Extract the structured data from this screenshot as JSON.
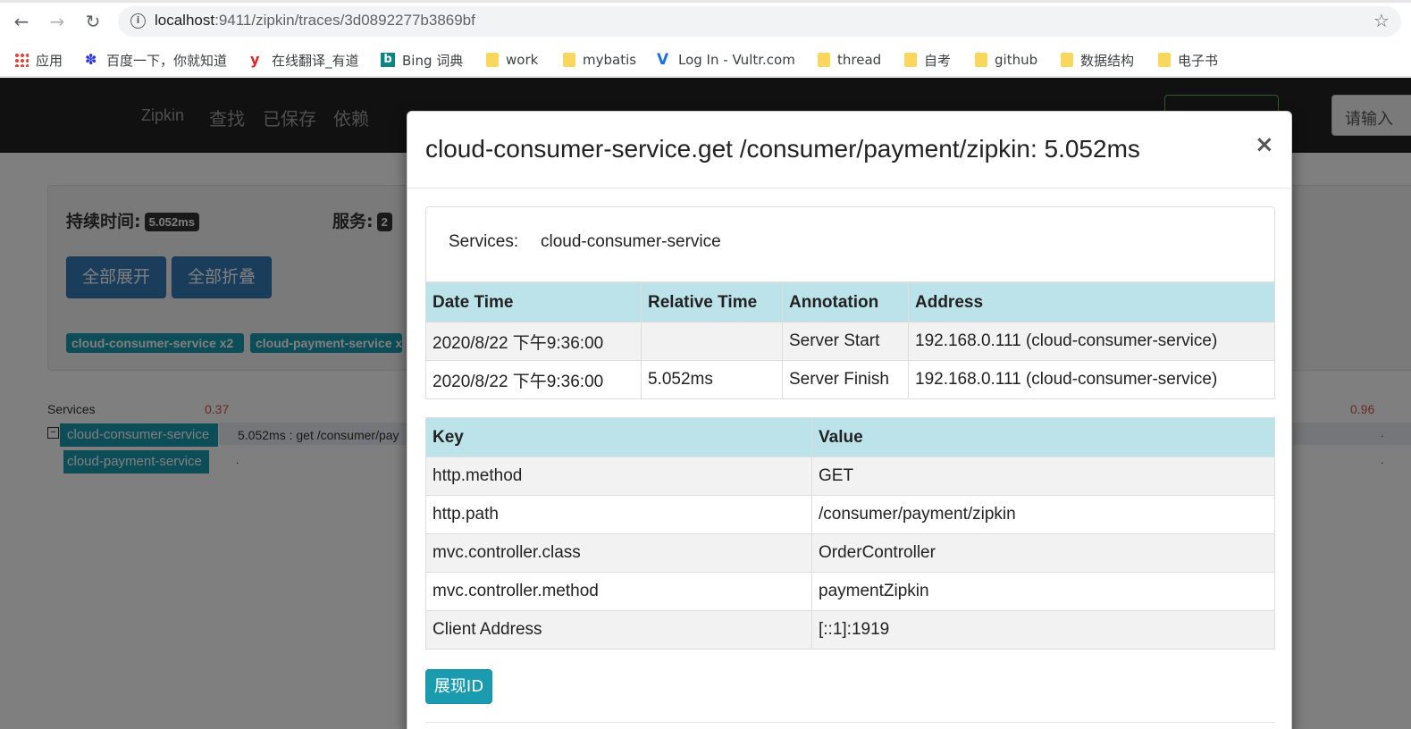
{
  "browser": {
    "url_host": "localhost",
    "url_path": ":9411/zipkin/traces/3d0892277b3869bf",
    "bookmarks": [
      {
        "label": "应用",
        "icon": "apps-grid-icon"
      },
      {
        "label": "百度一下，你就知道",
        "icon": "baidu-paw-icon"
      },
      {
        "label": "在线翻译_有道",
        "icon": "youdao-icon"
      },
      {
        "label": "Bing 词典",
        "icon": "bing-icon"
      },
      {
        "label": "work",
        "icon": "folder-icon"
      },
      {
        "label": "mybatis",
        "icon": "folder-icon"
      },
      {
        "label": "Log In - Vultr.com",
        "icon": "vultr-icon"
      },
      {
        "label": "thread",
        "icon": "folder-icon"
      },
      {
        "label": "自考",
        "icon": "folder-icon"
      },
      {
        "label": "github",
        "icon": "folder-icon"
      },
      {
        "label": "数据结构",
        "icon": "folder-icon"
      },
      {
        "label": "电子书",
        "icon": "folder-icon"
      }
    ]
  },
  "navbar": {
    "brand": "Zipkin",
    "links": [
      "查找",
      "已保存",
      "依赖"
    ],
    "search_placeholder": "请输入"
  },
  "summary": {
    "duration_label": "持续时间:",
    "duration_value": "5.052ms",
    "services_label": "服务:",
    "services_value": "2",
    "expand_all": "全部展开",
    "collapse_all": "全部折叠",
    "service_labels": [
      "cloud-consumer-service x2",
      "cloud-payment-service x"
    ]
  },
  "trace": {
    "services_header": "Services",
    "tick_left": "0.37",
    "tick_right": "0.96",
    "rows": [
      {
        "service": "cloud-consumer-service",
        "span": "5.052ms : get /consumer/pay"
      },
      {
        "service": "cloud-payment-service",
        "span": ""
      }
    ]
  },
  "modal": {
    "title": "cloud-consumer-service.get /consumer/payment/zipkin: 5.052ms",
    "services_label": "Services:",
    "services_value": "cloud-consumer-service",
    "annotation_headers": [
      "Date Time",
      "Relative Time",
      "Annotation",
      "Address"
    ],
    "annotations": [
      {
        "date_time": "2020/8/22 下午9:36:00",
        "relative_time": "",
        "annotation": "Server Start",
        "address": "192.168.0.111 (cloud-consumer-service)"
      },
      {
        "date_time": "2020/8/22 下午9:36:00",
        "relative_time": "5.052ms",
        "annotation": "Server Finish",
        "address": "192.168.0.111 (cloud-consumer-service)"
      }
    ],
    "kv_headers": [
      "Key",
      "Value"
    ],
    "tags": [
      {
        "key": "http.method",
        "value": "GET"
      },
      {
        "key": "http.path",
        "value": "/consumer/payment/zipkin"
      },
      {
        "key": "mvc.controller.class",
        "value": "OrderController"
      },
      {
        "key": "mvc.controller.method",
        "value": "paymentZipkin"
      },
      {
        "key": "Client Address",
        "value": "[::1]:1919"
      }
    ],
    "show_id_button": "展现ID",
    "close_symbol": "×"
  }
}
